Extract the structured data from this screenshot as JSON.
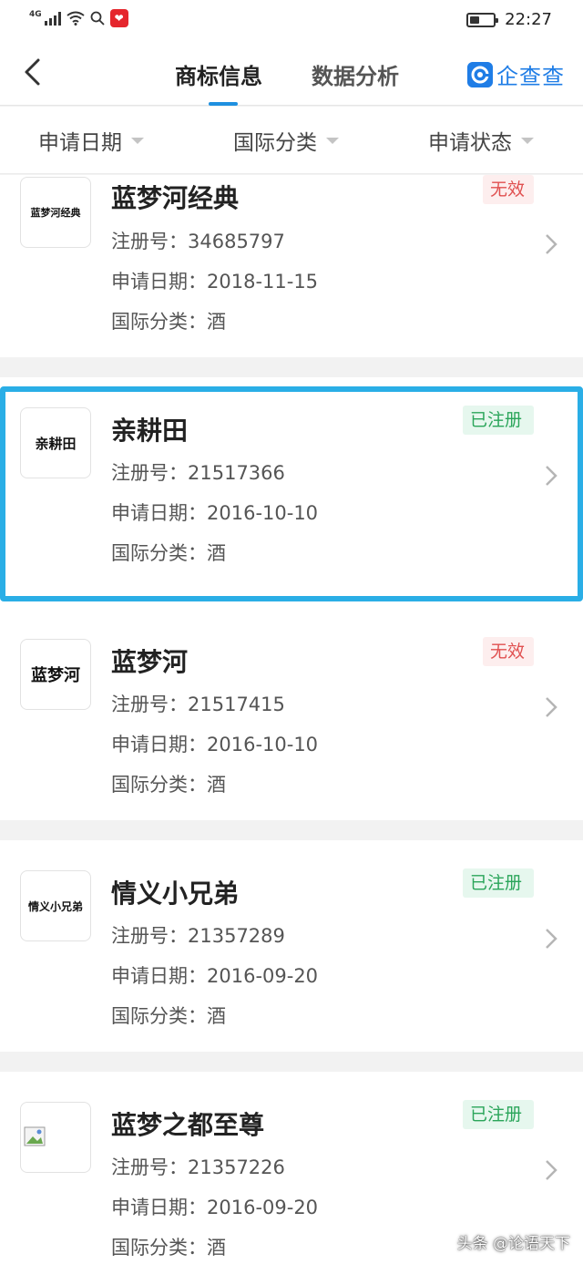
{
  "status_bar": {
    "network": "4G",
    "time": "22:27",
    "battery_level": 0.4,
    "app_icon": "pinduoduo-heart-icon"
  },
  "nav": {
    "tabs": [
      {
        "label": "商标信息",
        "active": true
      },
      {
        "label": "数据分析",
        "active": false
      }
    ],
    "brand": "企查查"
  },
  "filters": [
    {
      "label": "申请日期"
    },
    {
      "label": "国际分类"
    },
    {
      "label": "申请状态"
    }
  ],
  "trademarks": [
    {
      "thumb_text": "蓝梦河经典",
      "name": "蓝梦河经典",
      "status": "无效",
      "reg_no": "注册号：34685797",
      "apply_date": "申请日期：2018-11-15",
      "category": "国际分类：酒"
    },
    {
      "thumb_text": "亲耕田",
      "name": "亲耕田",
      "status": "已注册",
      "reg_no": "注册号：21517366",
      "apply_date": "申请日期：2016-10-10",
      "category": "国际分类：酒",
      "selected": true
    },
    {
      "thumb_text": "蓝梦河",
      "name": "蓝梦河",
      "status": "无效",
      "reg_no": "注册号：21517415",
      "apply_date": "申请日期：2016-10-10",
      "category": "国际分类：酒"
    },
    {
      "thumb_text": "情义小兄弟",
      "name": "情义小兄弟",
      "status": "已注册",
      "reg_no": "注册号：21357289",
      "apply_date": "申请日期：2016-09-20",
      "category": "国际分类：酒"
    },
    {
      "thumb_text": "",
      "name": "蓝梦之都至尊",
      "status": "已注册",
      "reg_no": "注册号：21357226",
      "apply_date": "申请日期：2016-09-20",
      "category": "国际分类：酒"
    }
  ],
  "colors": {
    "accent": "#1e90e0",
    "selection_border": "#2aaee6",
    "status_invalid": "#e05050",
    "status_registered": "#2aa55a"
  },
  "watermark": "头条 @论语天下"
}
